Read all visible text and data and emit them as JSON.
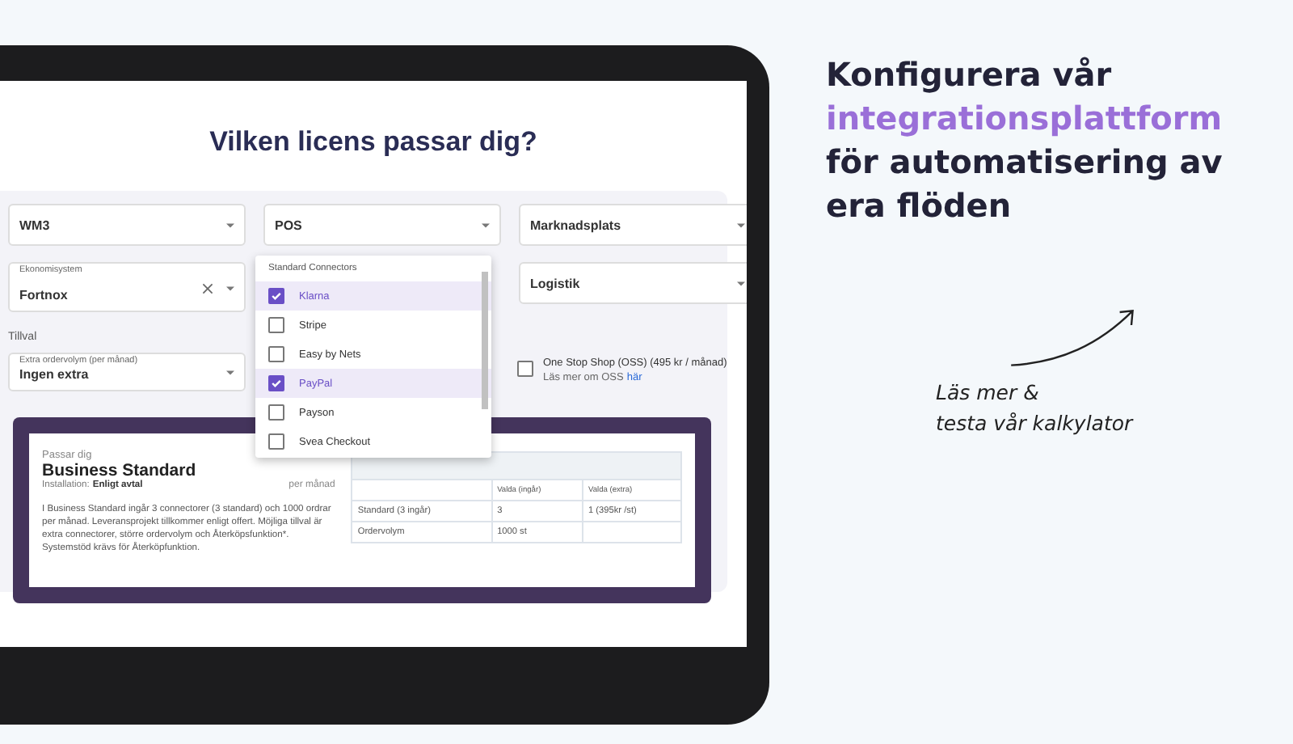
{
  "heading": "Vilken licens passar dig?",
  "fields": [
    {
      "value": "WM3"
    },
    {
      "value": "POS"
    },
    {
      "value": "Marknadsplats"
    },
    {
      "label": "Ekonomisystem",
      "value": "Fortnox",
      "clearable": true
    },
    {
      "value": "Logistik"
    }
  ],
  "addons_title": "Tillval",
  "order_volume": {
    "label": "Extra ordervolym (per månad)",
    "value": "Ingen extra"
  },
  "oss": {
    "checked": false,
    "label": "One Stop Shop (OSS) (495 kr / månad)",
    "note": "Läs mer om OSS",
    "link": "här"
  },
  "dropdown": {
    "group": "Standard Connectors",
    "items": [
      {
        "label": "Klarna",
        "checked": true
      },
      {
        "label": "Stripe",
        "checked": false
      },
      {
        "label": "Easy by Nets",
        "checked": false
      },
      {
        "label": "PayPal",
        "checked": true
      },
      {
        "label": "Payson",
        "checked": false
      },
      {
        "label": "Svea Checkout",
        "checked": false
      }
    ]
  },
  "result": {
    "eyebrow": "Passar dig",
    "plan": "Business Standard",
    "installation_label": "Installation:",
    "installation": "Enligt avtal",
    "price_unit": "per månad",
    "description": "I Business Standard ingår 3 connectorer (3 standard) och 1000 ordrar per månad. Leveransprojekt tillkommer enligt offert. Möjliga tillval är extra connectorer, större ordervolym och Återköpsfunktion*. Systemstöd krävs för Återköpfunktion.",
    "columns": [
      "Valda (ingår)",
      "Valda (extra)"
    ],
    "rows": [
      {
        "name": "Standard (3 ingår)",
        "included": "3",
        "extra": "1 (395kr /st)"
      },
      {
        "name": "Ordervolym",
        "included": "1000 st"
      }
    ]
  },
  "promo": {
    "before": "Konfigurera vår",
    "accent": "integrationsplattform",
    "after": "för automatisering av era flöden",
    "cta": [
      "Läs mer &",
      "testa vår kalkylator"
    ]
  }
}
